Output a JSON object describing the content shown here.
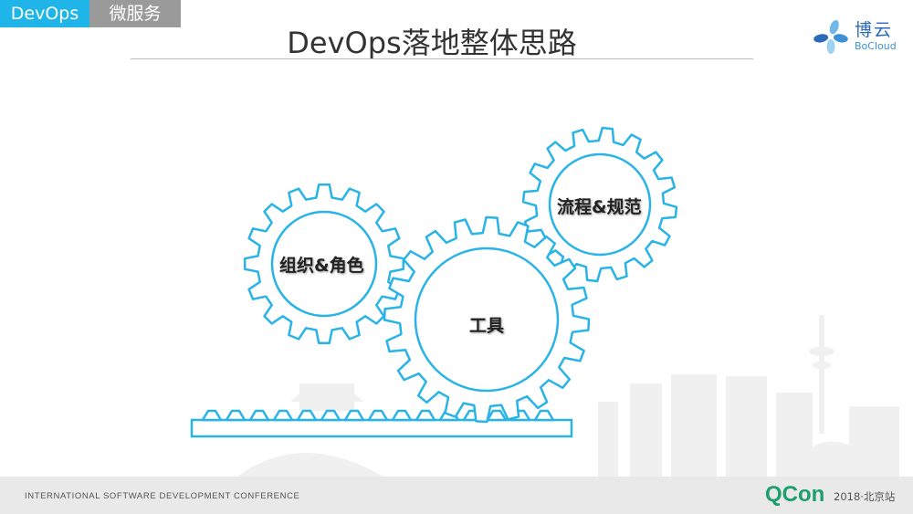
{
  "header": {
    "tab_active": "DevOps",
    "tab_inactive": "微服务",
    "title": "DevOps落地整体思路"
  },
  "logo": {
    "name_cn": "博云",
    "name_en": "BoCloud",
    "icon": "bocloud-flower-logo-icon"
  },
  "gears": {
    "left_label": "组织&角色",
    "center_label": "工具",
    "right_label": "流程&规范",
    "icon": "gear-icon"
  },
  "footer": {
    "conference": "INTERNATIONAL SOFTWARE DEVELOPMENT CONFERENCE",
    "brand": "QCon",
    "edition": "2018·北京站"
  },
  "colors": {
    "accent": "#1fb5e8",
    "tab_inactive": "#9a9a9a",
    "gear_stroke": "#29b3e6",
    "footer_bg": "#e9e9e9",
    "qcon_green": "#1d9f6b"
  }
}
